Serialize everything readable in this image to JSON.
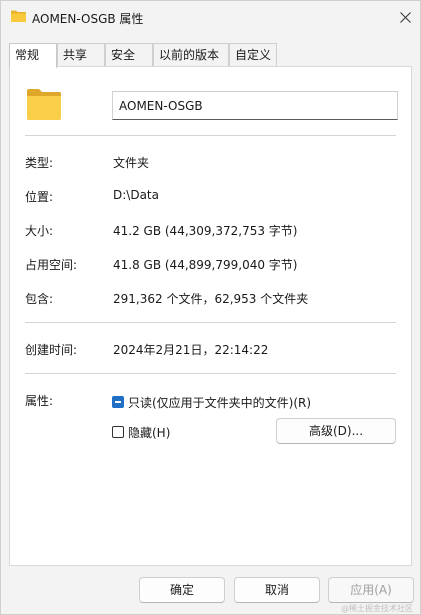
{
  "window": {
    "title": "AOMEN-OSGB 属性",
    "close_glyph": "✕"
  },
  "tabs": [
    {
      "label": "常规",
      "active": true
    },
    {
      "label": "共享",
      "active": false
    },
    {
      "label": "安全",
      "active": false
    },
    {
      "label": "以前的版本",
      "active": false
    },
    {
      "label": "自定义",
      "active": false
    }
  ],
  "general": {
    "name_value": "AOMEN-OSGB",
    "rows": [
      {
        "label": "类型:",
        "value": "文件夹"
      },
      {
        "label": "位置:",
        "value": "D:\\Data"
      },
      {
        "label": "大小:",
        "value": "41.2 GB (44,309,372,753 字节)"
      },
      {
        "label": "占用空间:",
        "value": "41.8 GB (44,899,799,040 字节)"
      },
      {
        "label": "包含:",
        "value": "291,362 个文件，62,953 个文件夹"
      }
    ],
    "created_label": "创建时间:",
    "created_value": "2024年2月21日，22:14:22",
    "attributes_label": "属性:",
    "readonly_label": "只读(仅应用于文件夹中的文件)(R)",
    "readonly_state": "indeterminate",
    "hidden_label": "隐藏(H)",
    "hidden_state": "unchecked",
    "advanced_button": "高级(D)..."
  },
  "footer": {
    "ok_label": "确定",
    "cancel_label": "取消",
    "apply_label": "应用(A)"
  },
  "watermark": "@稀土掘金技术社区",
  "colors": {
    "accent": "#1f6fc6",
    "folder": "#f8c93c"
  }
}
